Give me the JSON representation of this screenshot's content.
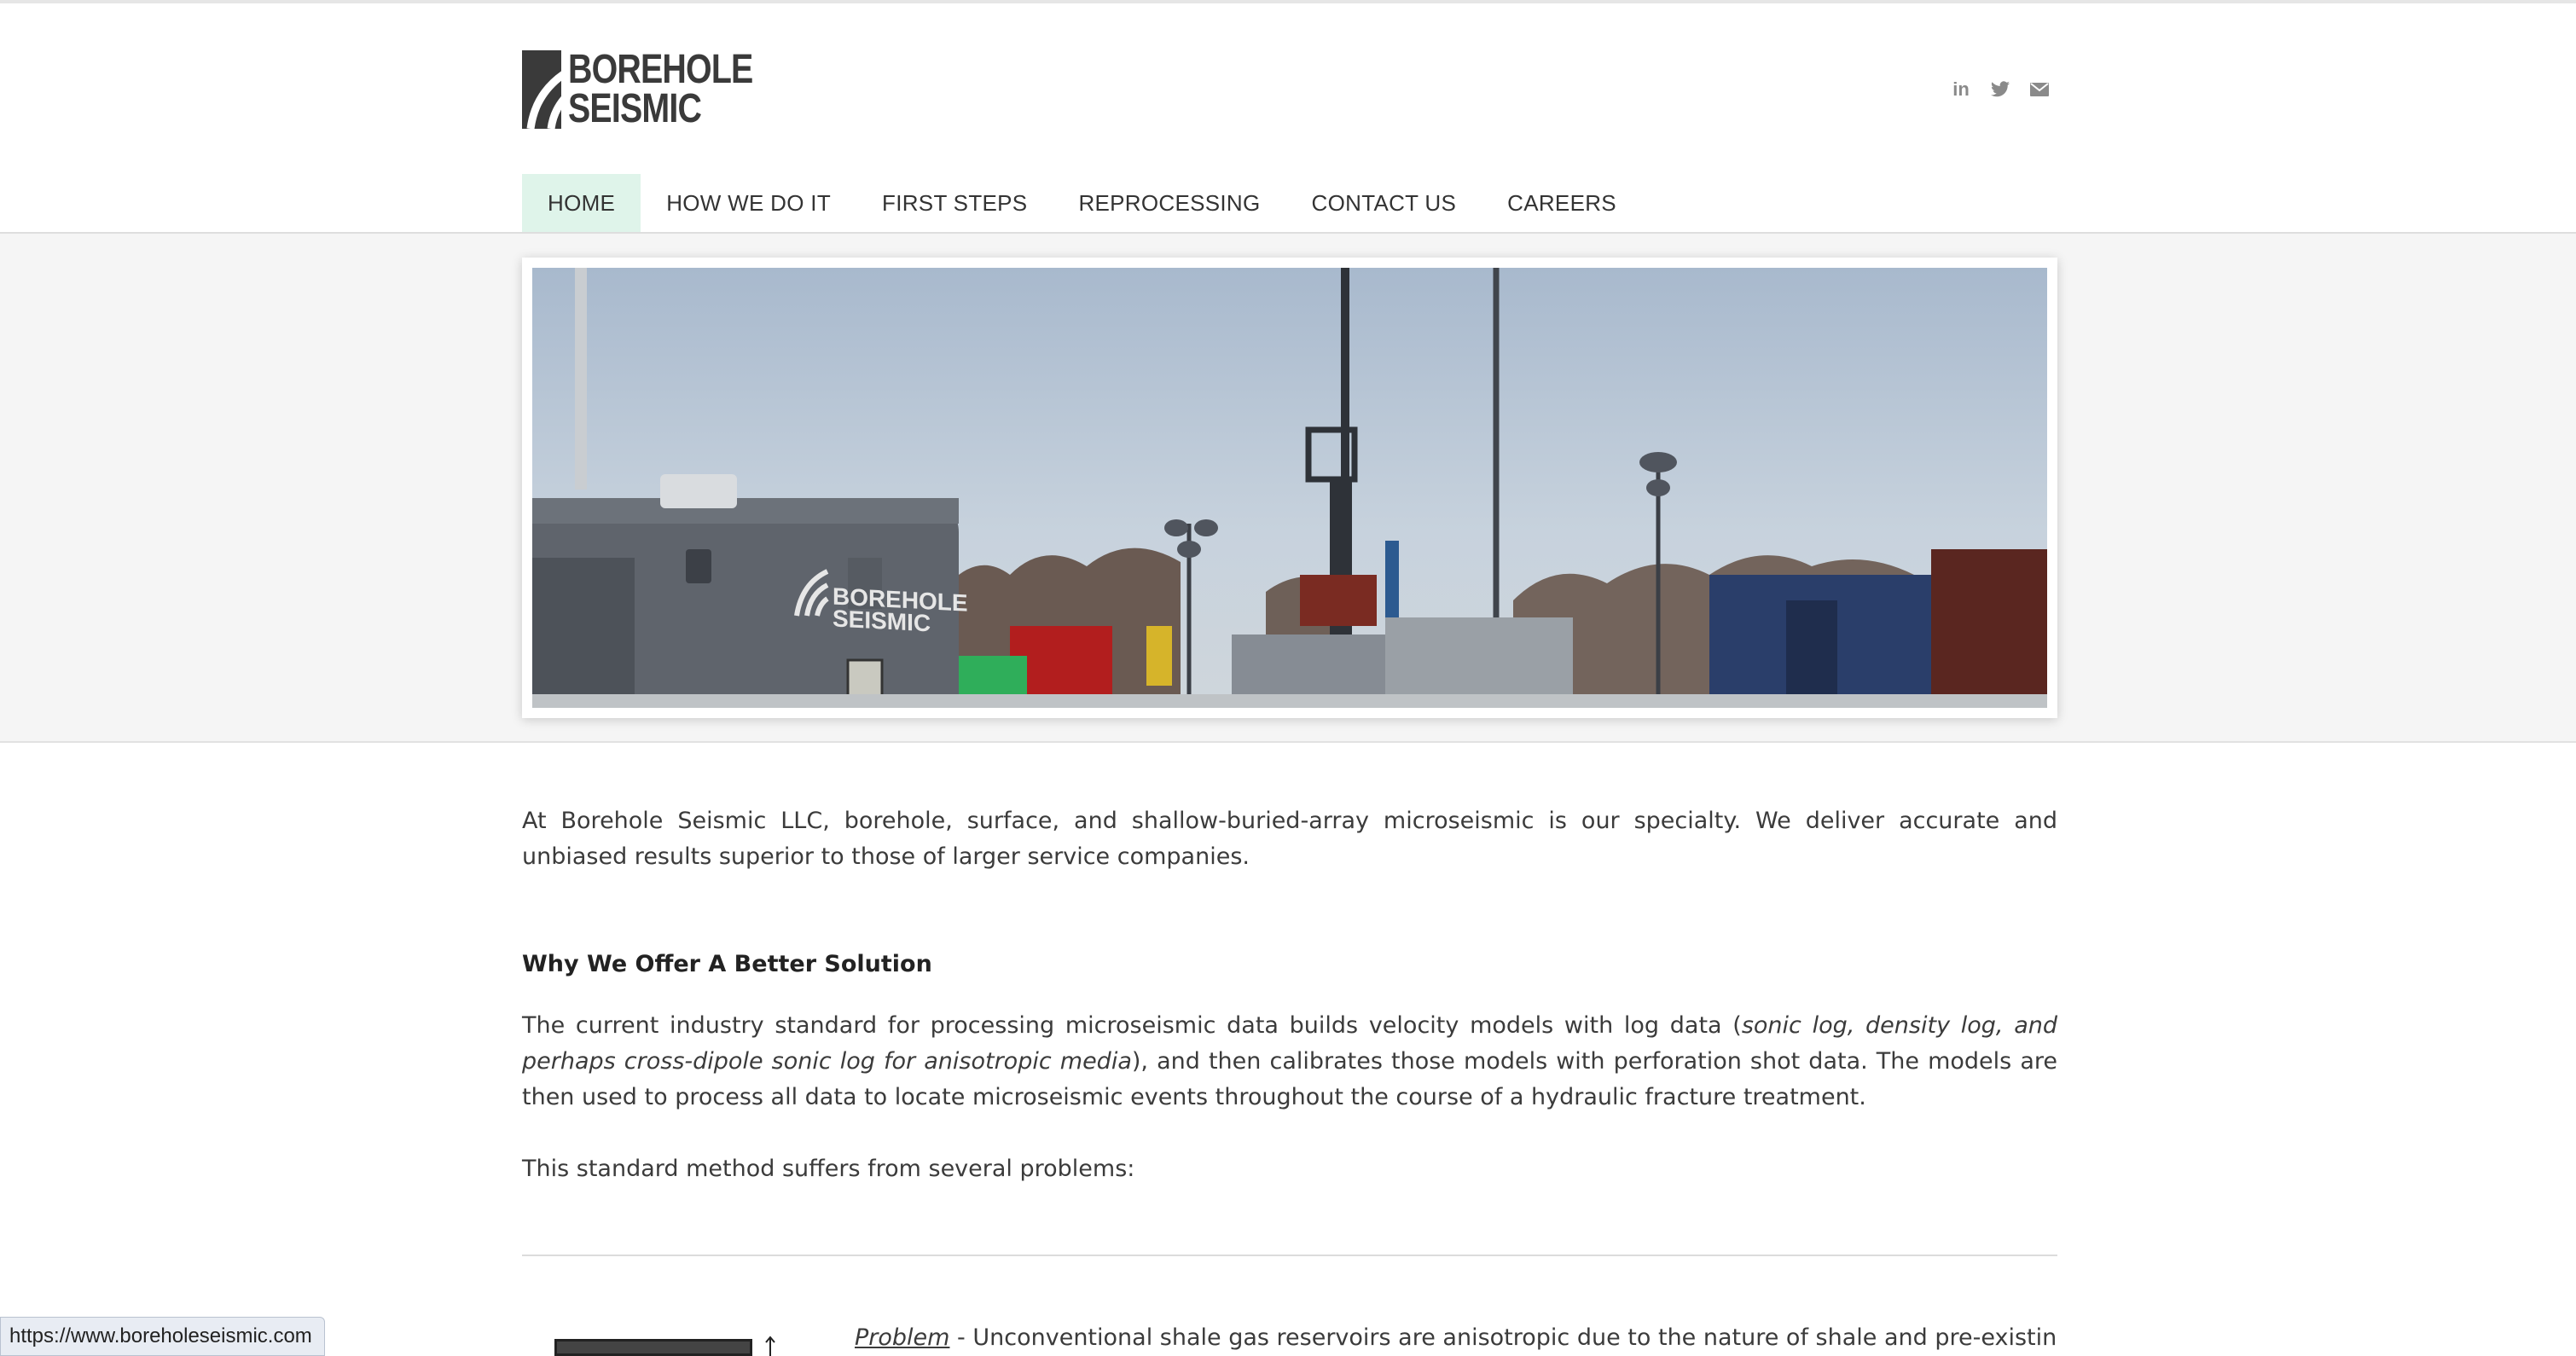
{
  "brand": {
    "line1": "BOREHOLE",
    "line2": "SEISMIC",
    "banner_line1": "BOREHOLE",
    "banner_line2": "SEISMIC"
  },
  "social": [
    {
      "name": "linkedin-icon",
      "label": "in"
    },
    {
      "name": "twitter-icon"
    },
    {
      "name": "email-icon"
    }
  ],
  "nav": {
    "items": [
      {
        "label": "HOME",
        "active": true
      },
      {
        "label": "HOW WE DO IT"
      },
      {
        "label": "FIRST STEPS"
      },
      {
        "label": "REPROCESSING"
      },
      {
        "label": "CONTACT US"
      },
      {
        "label": "CAREERS"
      }
    ]
  },
  "content": {
    "intro": "At Borehole Seismic LLC, borehole, surface, and shallow-buried-array microseismic is our specialty.  We deliver accurate and unbiased results superior to those of larger service companies.",
    "heading": "Why We Offer A Better Solution",
    "p1_start": "The current industry standard for processing microseismic data builds velocity models with log data (",
    "p1_italic": "sonic log, density log, and perhaps cross-dipole sonic log for anisotropic media",
    "p1_end": "), and then calibrates those models with perforation shot data.  The models are then used to process all data to locate microseismic events throughout the course of a hydraulic fracture treatment.",
    "p2": "This standard method suffers from several problems:",
    "problem_label": "Problem",
    "problem_text": " - Unconventional shale gas reservoirs are anisotropic due to the nature of shale and pre-existing"
  },
  "status": {
    "url": "https://www.boreholeseismic.com"
  },
  "colors": {
    "nav_active_bg": "#dff4ea",
    "logo": "#3a3a3a",
    "band_bg": "#f5f5f5"
  }
}
